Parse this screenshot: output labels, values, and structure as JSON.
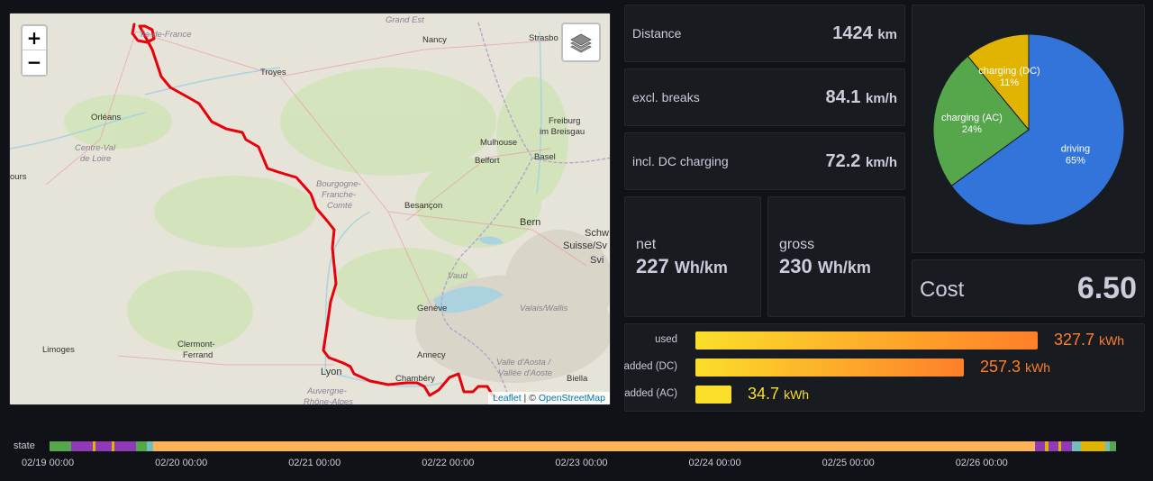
{
  "map": {
    "zoom_in": "+",
    "zoom_out": "−",
    "layers_icon": "layers-icon",
    "attribution_leaflet": "Leaflet",
    "attribution_sep": " | © ",
    "attribution_osm": "OpenStreetMap",
    "labels": {
      "ile_de_france": "Île-de-France",
      "grand_est": "Grand Est",
      "nancy": "Nancy",
      "strasbourg": "Strasbo",
      "troyes": "Troyes",
      "orleans": "Orléans",
      "centre_val_de_loire_1": "Centre-Val",
      "centre_val_de_loire_2": "de Loire",
      "tours": "ours",
      "freiburg_1": "Freiburg",
      "freiburg_2": "im Breisgau",
      "mulhouse": "Mulhouse",
      "belfort": "Belfort",
      "basel": "Basel",
      "bourgogne_1": "Bourgogne-",
      "bourgogne_2": "Franche-",
      "bourgogne_3": "Comté",
      "besancon": "Besançon",
      "bern": "Bern",
      "schweiz_1": "Schw",
      "schweiz_2": "Suisse/Sv",
      "schweiz_3": "Svi",
      "vaud": "Vaud",
      "geneve": "Genève",
      "valais": "Valais/Wallis",
      "limoges": "Limoges",
      "clermont_1": "Clermont-",
      "clermont_2": "Ferrand",
      "lyon": "Lyon",
      "annecy": "Annecy",
      "aosta_1": "Valle d'Aosta /",
      "aosta_2": "Vallée d'Aoste",
      "biella": "Biella",
      "auvergne_1": "Auvergne-",
      "auvergne_2": "Rhône-Alpes",
      "chambery": "Chambéry"
    }
  },
  "stats": {
    "distance": {
      "label": "Distance",
      "value": "1424",
      "unit": "km"
    },
    "excl_breaks": {
      "label": "excl. breaks",
      "value": "84.1",
      "unit": "km/h"
    },
    "incl_dc": {
      "label": "incl. DC charging",
      "value": "72.2",
      "unit": "km/h"
    },
    "net": {
      "label": "net",
      "value": "227",
      "unit": "Wh/km"
    },
    "gross": {
      "label": "gross",
      "value": "230",
      "unit": "Wh/km"
    },
    "cost": {
      "label": "Cost",
      "value": "6.50"
    }
  },
  "pie": {
    "slices": [
      {
        "name": "driving",
        "pct_label": "65%",
        "value": 65,
        "color": "#3274d9"
      },
      {
        "name": "charging (AC)",
        "pct_label": "24%",
        "value": 24,
        "color": "#56a64b"
      },
      {
        "name": "charging (DC)",
        "pct_label": "11%",
        "value": 11,
        "color": "#e0b400"
      }
    ]
  },
  "energy": {
    "max": 327.7,
    "rows": [
      {
        "label": "used",
        "value": "327.7",
        "num": 327.7,
        "unit": "kWh",
        "color": "#ff7f2a"
      },
      {
        "label": "added (DC)",
        "value": "257.3",
        "unit": "kWh",
        "num": 257.3,
        "color": "#ff7f2a"
      },
      {
        "label": "added (AC)",
        "value": "34.7",
        "unit": "kWh",
        "num": 34.7,
        "color": "#fade2a"
      }
    ]
  },
  "timeline": {
    "label": "state",
    "ticks": [
      "02/19 00:00",
      "02/20 00:00",
      "02/21 00:00",
      "02/22 00:00",
      "02/23 00:00",
      "02/24 00:00",
      "02/25 00:00",
      "02/26 00:00"
    ],
    "colors": {
      "parked": "#ffb357",
      "driving": "#56a64b",
      "charging": "#8f3bb8",
      "dc": "#e0b400",
      "online": "#73bfb8"
    }
  }
}
